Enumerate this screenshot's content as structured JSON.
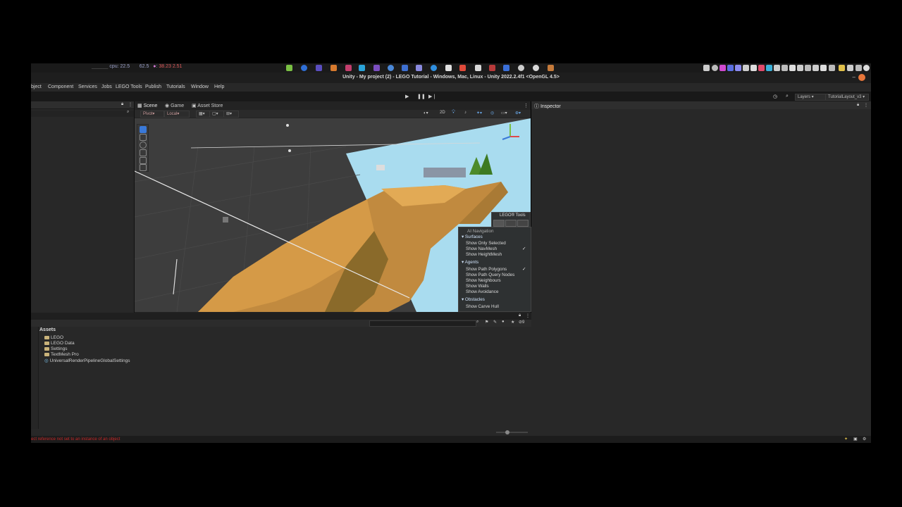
{
  "sysbar": {
    "cpu_text": "cpu: 22.5",
    "mem_text": "62.5",
    "temp_text": "38.23",
    "load_text": "2.51"
  },
  "window": {
    "title": "Unity - My project (2) - LEGO Tutorial - Windows, Mac, Linux - Unity 2022.2.4f1 <OpenGL 4.5>"
  },
  "menu": {
    "items": [
      "bject",
      "Component",
      "Services",
      "Jobs",
      "LEGO Tools",
      "Publish",
      "Tutorials",
      "Window",
      "Help"
    ]
  },
  "toolbar": {
    "layers_label": "Layers",
    "layout_label": "TutorialLayout_v3"
  },
  "scene": {
    "tabs": [
      "Scene",
      "Game",
      "Asset Store"
    ],
    "pivot_label": "Pivot",
    "local_label": "Local",
    "mode_2d": "2D"
  },
  "lego_tools": {
    "label": "LEGO® Tools"
  },
  "nav_overlay": {
    "title": "AI Navigation",
    "surfaces_label": "Surfaces",
    "show_only_selected": "Show Only Selected",
    "show_navmesh": "Show NavMesh",
    "show_heightmesh": "Show HeightMesh",
    "agents_label": "Agents",
    "show_path_polygons": "Show Path Polygons",
    "show_path_query_nodes": "Show Path Query Nodes",
    "show_neighbours": "Show Neighbours",
    "show_walls": "Show Walls",
    "show_avoidance": "Show Avoidance",
    "obstacles_label": "Obstacles",
    "show_carve_hull": "Show Carve Hull",
    "checkmark": "✓"
  },
  "inspector": {
    "tab_label": "Inspector"
  },
  "project": {
    "assets_label": "Assets",
    "items": [
      "LEGO",
      "LEGO Data",
      "Settings",
      "TextMesh Pro",
      "UniversalRenderPipelineGlobalSettings"
    ],
    "hidden_count": "9"
  },
  "status": {
    "error_text": "ect reference not set to an instance of an object"
  },
  "colors": {
    "accent_blue": "#3a79d8",
    "close_orange": "#e8763a",
    "error_red": "#c62828",
    "terrain": "#c18a3f",
    "sky": "#a9dcef"
  }
}
